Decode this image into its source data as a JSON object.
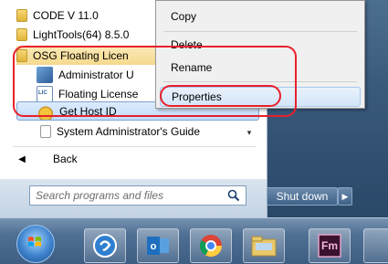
{
  "programs": [
    {
      "label": "CODE V 11.0"
    },
    {
      "label": "LightTools(64) 8.5.0"
    },
    {
      "label": "OSG Floating Licen"
    },
    {
      "label": "Administrator U"
    },
    {
      "label": "Floating License"
    },
    {
      "label": "Get Host ID"
    },
    {
      "label": "System Administrator's Guide"
    }
  ],
  "back_label": "Back",
  "search": {
    "placeholder": "Search programs and files"
  },
  "shutdown": {
    "label": "Shut down"
  },
  "context_menu": {
    "copy": "Copy",
    "delete": "Delete",
    "rename": "Rename",
    "properties": "Properties"
  },
  "taskbar": {
    "apps": [
      "start-orb",
      "chat-app-icon",
      "outlook-icon",
      "chrome-icon",
      "file-explorer-icon",
      "framemaker-icon"
    ],
    "fm_label": "Fm"
  },
  "colors": {
    "annotation": "#e8202a",
    "taskbar": "#4f6f94"
  }
}
